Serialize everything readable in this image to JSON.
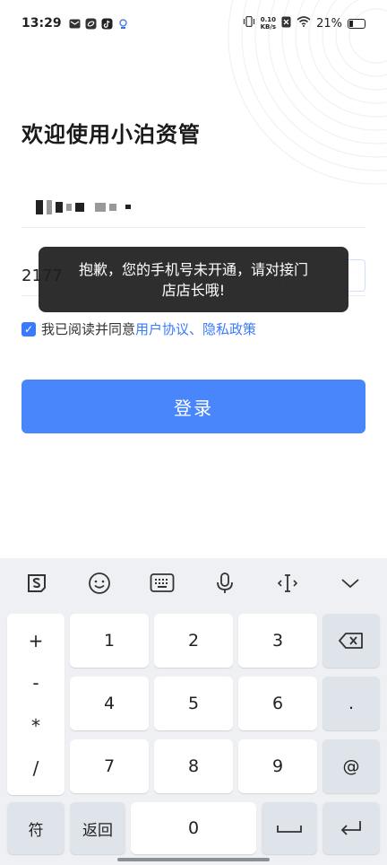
{
  "status_bar": {
    "time": "13:29",
    "net_speed_value": "0.10",
    "net_speed_unit": "KB/s",
    "battery": "21%"
  },
  "page": {
    "title": "欢迎使用小泊资管",
    "code_value": "2177",
    "agree_prefix": "我已阅读并同意",
    "agree_links": "用户协议、隐私政策",
    "login_label": "登录"
  },
  "toast": {
    "line1": "抱歉，您的手机号未开通，请对接门",
    "line2": "店店长哦!"
  },
  "keyboard": {
    "toolbar_icons": [
      "sogou-logo-icon",
      "emoji-icon",
      "keyboard-icon",
      "microphone-icon",
      "cursor-icon",
      "collapse-icon"
    ],
    "symbols": [
      "+",
      "-",
      "*",
      "/"
    ],
    "digits": [
      "1",
      "2",
      "3",
      "4",
      "5",
      "6",
      "7",
      "8",
      "9",
      "0"
    ],
    "dot": ".",
    "at": "@",
    "symbol_key": "符",
    "back_key": "返回"
  },
  "colors": {
    "accent": "#3a7afe",
    "login_button": "#4a86fb",
    "keyboard_bg": "#eef0f3"
  }
}
